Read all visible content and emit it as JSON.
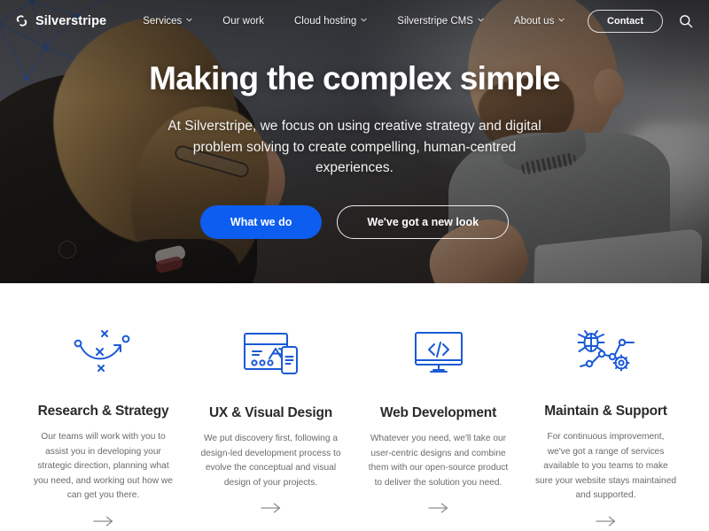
{
  "nav": {
    "logo": {
      "name": "Silverstripe",
      "icon": "silverstripe-logo-icon"
    },
    "links": [
      {
        "label": "Services",
        "has_chevron": true
      },
      {
        "label": "Our work",
        "has_chevron": false
      },
      {
        "label": "Cloud hosting",
        "has_chevron": true
      },
      {
        "label": "Silverstripe CMS",
        "has_chevron": true
      },
      {
        "label": "About us",
        "has_chevron": true
      }
    ],
    "contact_label": "Contact",
    "search_icon": "search-icon"
  },
  "hero": {
    "title": "Making the complex simple",
    "subtitle": "At Silverstripe, we focus on using creative strategy and digital problem solving to create compelling, human-centred experiences.",
    "primary_button": "What we do",
    "secondary_button": "We've got a new look"
  },
  "features": [
    {
      "icon": "strategy-playbook-icon",
      "title": "Research & Strategy",
      "body": "Our teams will work with you to assist you in developing your strategic direction, planning what you need, and working out how we can get you there.",
      "arrow": "arrow-right-icon"
    },
    {
      "icon": "browser-mobile-design-icon",
      "title": "UX & Visual Design",
      "body": "We put discovery first, following a design-led development process to evolve the conceptual and visual design of your projects.",
      "arrow": "arrow-right-icon"
    },
    {
      "icon": "monitor-code-icon",
      "title": "Web Development",
      "body": "Whatever you need, we'll take our user-centric designs and combine them with our open-source product to deliver the solution you need.",
      "arrow": "arrow-right-icon"
    },
    {
      "icon": "bug-network-gear-icon",
      "title": "Maintain & Support",
      "body": "For continuous improvement, we've got a range of services available to you teams to make sure your website stays maintained and supported.",
      "arrow": "arrow-right-icon"
    }
  ],
  "colors": {
    "accent_blue": "#0d5df0",
    "icon_blue": "#1a5ad6",
    "heading": "#2b2b2b",
    "body_text": "#6a6a6a",
    "page_bg": "#ffffff"
  }
}
